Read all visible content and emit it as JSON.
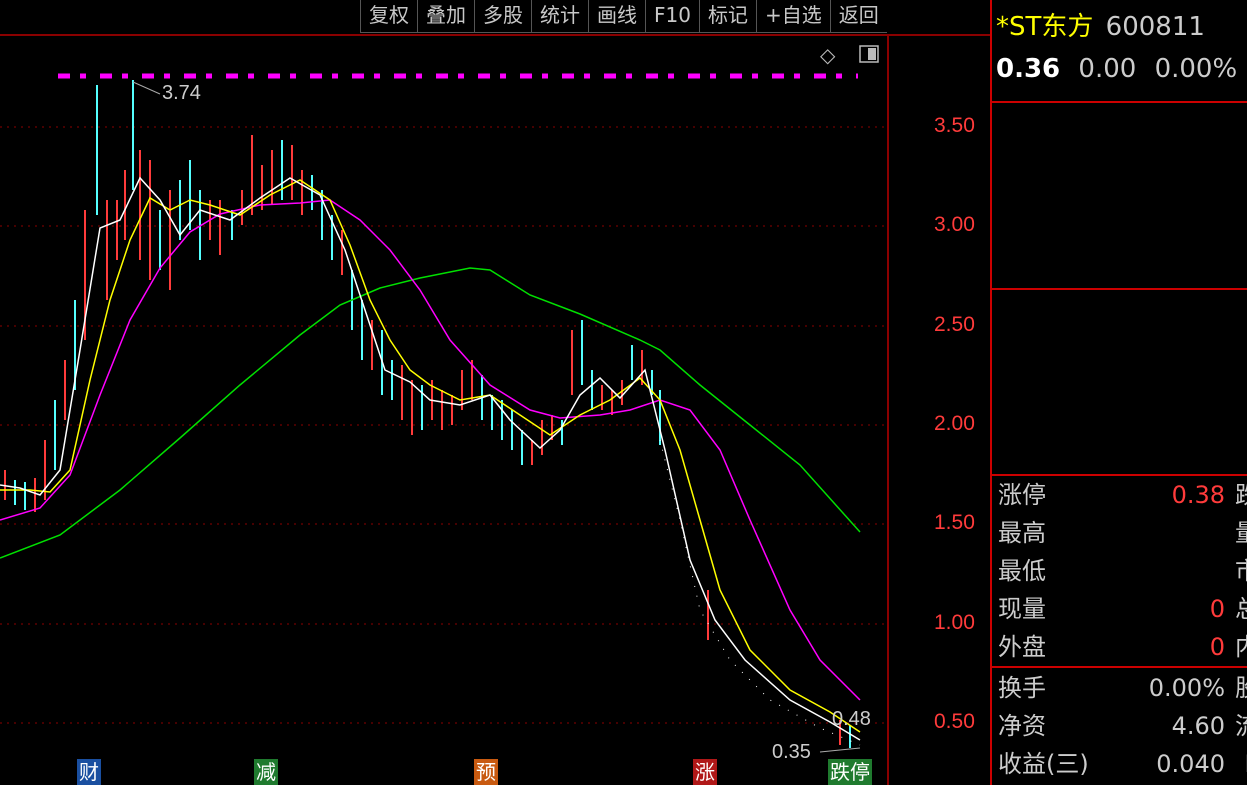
{
  "toolbar": {
    "items": [
      "复权",
      "叠加",
      "多股",
      "统计",
      "画线",
      "F10",
      "标记",
      "+自选",
      "返回"
    ]
  },
  "stock": {
    "name": "*ST东方",
    "code": "600811",
    "price": "0.36",
    "change": "0.00",
    "change_pct": "0.00%"
  },
  "yaxis": {
    "ticks": [
      "3.50",
      "3.00",
      "2.50",
      "2.00",
      "1.50",
      "1.00",
      "0.50"
    ]
  },
  "annotations": {
    "high_label": "3.74",
    "low_label": "0.35",
    "last_label": "0.48"
  },
  "event_markers": [
    {
      "label": "财",
      "color": "#1a4fa0"
    },
    {
      "label": "减",
      "color": "#1f7a2e"
    },
    {
      "label": "预",
      "color": "#c85a10"
    },
    {
      "label": "涨",
      "color": "#b01818"
    },
    {
      "label": "跌停",
      "color": "#1f7a2e"
    }
  ],
  "quote_fields": [
    {
      "label": "涨停",
      "value": "0.38",
      "suffix": "跌",
      "value_color": "#ff3b3b"
    },
    {
      "label": "最高",
      "value": "",
      "suffix": "量",
      "value_color": "#ccc"
    },
    {
      "label": "最低",
      "value": "",
      "suffix": "市",
      "value_color": "#ccc"
    },
    {
      "label": "现量",
      "value": "0",
      "suffix": "总",
      "value_color": "#ff3b3b"
    },
    {
      "label": "外盘",
      "value": "0",
      "suffix": "内",
      "value_color": "#ff3b3b"
    },
    {
      "label": "换手",
      "value": "0.00%",
      "suffix": "股",
      "value_color": "#ccc"
    },
    {
      "label": "净资",
      "value": "4.60",
      "suffix": "流",
      "value_color": "#ccc"
    },
    {
      "label": "收益(三)",
      "value": "0.040",
      "suffix": "P",
      "value_color": "#ccc"
    }
  ],
  "colors": {
    "up": "#ff3b3b",
    "down": "#54ffff",
    "ma5": "#ffffff",
    "ma10": "#ffff00",
    "ma20": "#ff00ff",
    "ma60": "#00e000",
    "grid": "#8b0000",
    "accent": "#ff3b3b"
  }
}
